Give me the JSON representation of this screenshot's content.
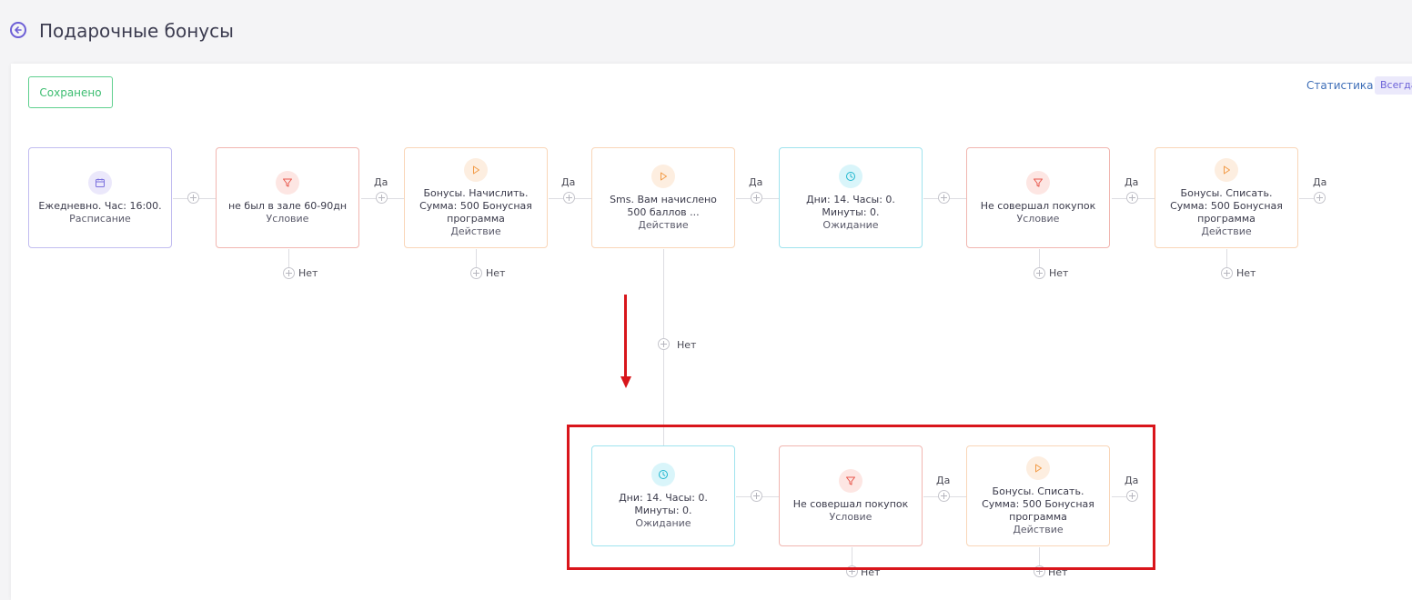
{
  "header": {
    "title": "Подарочные бонусы"
  },
  "toolbar": {
    "saved_label": "Сохранено",
    "stats_label": "Статистика",
    "always_label": "Всегда"
  },
  "labels": {
    "yes": "Да",
    "no": "Нет"
  },
  "row1": [
    {
      "text": "Ежедневно. Час: 16:00.",
      "type": "Расписание",
      "icon": "calendar-icon"
    },
    {
      "text": "не был в зале 60-90дн",
      "type": "Условие",
      "icon": "filter-icon"
    },
    {
      "text": "Бонусы. Начислить. Сумма: 500 Бонусная программа",
      "type": "Действие",
      "icon": "play-icon"
    },
    {
      "text": "Sms. Вам начислено 500 баллов ...",
      "type": "Действие",
      "icon": "play-icon"
    },
    {
      "text": "Дни: 14. Часы: 0. Минуты: 0.",
      "type": "Ожидание",
      "icon": "clock-icon"
    },
    {
      "text": "Не совершал покупок",
      "type": "Условие",
      "icon": "filter-icon"
    },
    {
      "text": "Бонусы. Списать. Сумма: 500 Бонусная программа",
      "type": "Действие",
      "icon": "play-icon"
    }
  ],
  "row2": [
    {
      "text": "Дни: 14. Часы: 0. Минуты: 0.",
      "type": "Ожидание",
      "icon": "clock-icon"
    },
    {
      "text": "Не совершал покупок",
      "type": "Условие",
      "icon": "filter-icon"
    },
    {
      "text": "Бонусы. Списать. Сумма: 500 Бонусная программа",
      "type": "Действие",
      "icon": "play-icon"
    }
  ],
  "colors": {
    "accent": "#6d5fd6",
    "saved": "#3dbd71",
    "condition": "#e8574c",
    "action": "#f29a45",
    "wait": "#1fb7cf",
    "highlight": "#d9151b"
  }
}
